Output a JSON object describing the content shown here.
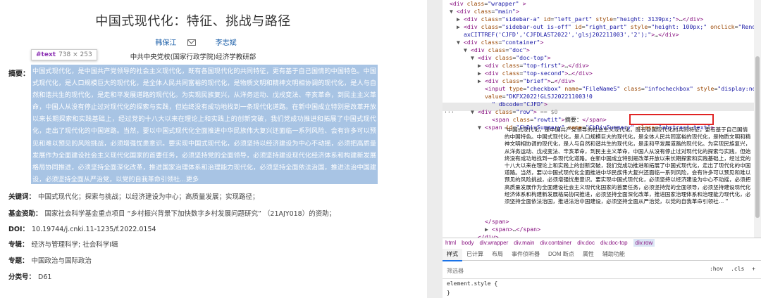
{
  "article": {
    "title": "中国式现代化：特征、挑战与路径",
    "authors": [
      "韩保江",
      "李志斌"
    ],
    "affiliation": "中共中央党校(国家行政学院)经济学教研部",
    "tooltip_tag": "#text",
    "tooltip_size": "738 × 253",
    "abstract_label": "摘要：",
    "abstract_text": "中国式现代化，是中国共产党领导的社会主义现代化，既有各国现代化的共同特征，更有基于自己国情的中国特色。中国式现代化，是人口规模巨大的现代化，是全体人民共同富裕的现代化，是物质文明和精神文明相协调的现代化，是人与自然和谐共生的现代化，是走和平发展道路的现代化。为实现民族复兴，从洋务运动、戊戌变法、辛亥革命，到民主主义革命，中国人从没有停止过对现代化的探索与实践，但始终没有成功地找到一条现代化道路。在新中国成立特别是改革开放以来长期探索和实践基础上，经过党的十八大以来在理论上和实践上的创新突破，我们党成功推进和拓展了中国式现代化，走出了现代化的中国道路。当然，要以中国式现代化全面推进中华民族伟大复兴还面临一系列风险、会有许多可以预见和难以预见的风险挑战，必须增强忧患意识。要实现中国式现代化，必须坚持以经济建设为中心不动摇，必须把高质量发展作为全面建设社会主义现代化国家的首要任务，必须坚持党的全面领导，必须坚持建设现代化经济体系和构建新发展格局协同推进，必须坚持全面深化改革，推进国家治理体系和治理能力现代化，必须坚持全面依法治国，推进法治中国建设，必须坚持全面从严治党，以党的自我革命引领社",
    "abstract_more": "...更多",
    "keywords_label": "关键词：",
    "keywords": "中国式现代化；探索与挑战；以经济建设为中心；高质量发展；实现路径；",
    "fund_label": "基金资助：",
    "fund": "国家社会科学基金重点项目 “乡村振兴背景下加快数字乡村发展问题研究” （21AJY018）的资助；",
    "doi_label": "DOI：",
    "doi": "10.19744/j.cnki.11-1235/f.2022.0154",
    "topic_label": "专辑：",
    "topic": "经济与管理科学; 社会科学Ⅰ辑",
    "subject_label": "专题：",
    "subject": "中国政治与国际政治",
    "class_label": "分类号：",
    "class": "D61"
  },
  "devtools": {
    "lines": [
      {
        "indent": 0,
        "tri": "",
        "html": "<span class='tg'>&lt;div</span> <span class='at'>class</span>=<span class='av'>\"wrapper\"</span> <span class='tg'>&gt;</span>"
      },
      {
        "indent": 1,
        "tri": "▼",
        "html": "<span class='tg'>&lt;div</span> <span class='at'>class</span>=<span class='av'>\"main\"</span><span class='tg'>&gt;</span>"
      },
      {
        "indent": 2,
        "tri": "▶",
        "html": "<span class='tg'>&lt;div</span> <span class='at'>class</span>=<span class='av'>\"sidebar-a\"</span> <span class='at'>id</span>=<span class='av'>\"left_part\"</span> <span class='at'>style</span>=<span class='av'>\"height: 3139px;\"</span><span class='tg'>&gt;</span>…<span class='tg'>&lt;/div&gt;</span>"
      },
      {
        "indent": 2,
        "tri": "▶",
        "html": "<span class='tg'>&lt;div</span> <span class='at'>class</span>=<span class='av'>\"sidebar-out is-off\"</span> <span class='at'>id</span>=<span class='av'>\"right_part\"</span> <span class='at'>style</span>=<span class='av'>\"height: 100px;\"</span> <span class='at'>onclick</span>=<span class='av'>\"RenderAj</span>"
      },
      {
        "indent": 2,
        "tri": "",
        "html": "<span class='av'>axCITTREF('CJFD','CJFDLAST2022','glsj202211003','2');\"</span><span class='tg'>&gt;</span>…<span class='tg'>&lt;/div&gt;</span>"
      },
      {
        "indent": 2,
        "tri": "▼",
        "html": "<span class='tg'>&lt;div</span> <span class='at'>class</span>=<span class='av'>\"container\"</span><span class='tg'>&gt;</span>"
      },
      {
        "indent": 3,
        "tri": "▼",
        "html": "<span class='tg'>&lt;div</span> <span class='at'>class</span>=<span class='av'>\"doc\"</span><span class='tg'>&gt;</span>"
      },
      {
        "indent": 4,
        "tri": "▼",
        "html": "<span class='tg'>&lt;div</span> <span class='at'>class</span>=<span class='av'>\"doc-top\"</span><span class='tg'>&gt;</span>"
      },
      {
        "indent": 5,
        "tri": "▶",
        "html": "<span class='tg'>&lt;div</span> <span class='at'>class</span>=<span class='av'>\"top-first\"</span><span class='tg'>&gt;</span>…<span class='tg'>&lt;/div&gt;</span>"
      },
      {
        "indent": 5,
        "tri": "▶",
        "html": "<span class='tg'>&lt;div</span> <span class='at'>class</span>=<span class='av'>\"top-second\"</span><span class='tg'>&gt;</span>…<span class='tg'>&lt;/div&gt;</span>"
      },
      {
        "indent": 5,
        "tri": "▶",
        "html": "<span class='tg'>&lt;div</span> <span class='at'>class</span>=<span class='av'>\"brief\"</span><span class='tg'>&gt;</span>…<span class='tg'>&lt;/div&gt;</span>"
      },
      {
        "indent": 5,
        "tri": "",
        "html": "<span class='tg'>&lt;input</span> <span class='at'>type</span>=<span class='av'>\"checkbox\"</span> <span class='at'>name</span>=<span class='av'>\"FileNameS\"</span> <span class='at'>class</span>=<span class='av'>\"infocheckbox\"</span> <span class='at'>style</span>=<span class='av'>\"display:none\"</span>"
      },
      {
        "indent": 5,
        "tri": "",
        "html": "<span class='at'>value</span>=<span class='av'>\"DKFX2022!GLSJ202211003!0</span>"
      },
      {
        "indent": 6,
        "tri": "",
        "html": "<span class='av'>\" dbcode=\"CJFD\"</span><span class='tg'>&gt;</span>"
      },
      {
        "indent": 4,
        "tri": "▼",
        "html": "<span class='tg'>&lt;div</span> <span class='at'>class</span>=<span class='av'>\"row\"</span><span class='tg'>&gt;</span> <span class='cm'>== $0</span>"
      },
      {
        "indent": 6,
        "tri": "",
        "html": "<span class='tg'>&lt;span</span> <span class='at'>class</span>=<span class='av'>\"rowtit\"</span><span class='tg'>&gt;</span><span class='tx'>摘要：</span><span class='tg'>&lt;/span&gt;</span>"
      },
      {
        "indent": 5,
        "tri": "▼",
        "html": "<span class='tg'>&lt;span</span> <span class='at'>id</span>=<span class='av'>\"ChDivSummary\"</span> <span class='at'>name</span>=<span class='av'>\"ChDivSummary\"</span> <span class='at'>class</span>=<span class='av'>\"abstract-text\"</span><span class='tg'>&gt;</span>"
      }
    ],
    "text_node": "\"中国式现代化，是中国共产党领导的社会主义现代化，既有各国现代化的共同特征，更有基于自己国情的中国特色。中国式现代化，是人口规模巨大的现代化，是全体人民共同富裕的现代化，是物质文明和精神文明相协调的现代化，是人与自然和谐共生的现代化，是走和平发展道路的现代化。为实现民族复兴，从洋务运动、戊戌变法、辛亥革命，到民主主义革命，中国人从没有停止过对现代化的探索与实践，但始终没有成功地找到一条现代化道路。在新中国成立特别是改革开放以来长期探索和实践基础上，经过党的十八大以来在理论上和实践上的创新突破，我们党成功推进和拓展了中国式现代化，走出了现代化的中国道路。当然，要以中国式现代化全面推进中华民族伟大复兴还面临一系列风险，会有许多可以预见和难以预见的风险挑战，必须增强忧患意识。要实现中国式现代化，必须坚持以经济建设为中心不动摇，必须把高质量发展作为全面建设社会主义现代化国家的首要任务，必须坚持党的全面领导，必须坚持建设现代化经济体系和构建新发展格局协同推进，必须坚持全面深化改革，推进国家治理体系和治理能力现代化，必须坚持全面依法治国，推进法治中国建设，必须坚持全面从严治党，以党的自我革命引领社…&nbsp;\"",
    "tail_lines": [
      {
        "indent": 5,
        "html": "<span class='tg'>&lt;/span&gt;</span>"
      },
      {
        "indent": 5,
        "html": "<span class='tri'>▶</span><span class='tg'>&lt;span&gt;</span>…<span class='tg'>&lt;/span&gt;</span>"
      },
      {
        "indent": 4,
        "html": "<span class='tg'>&lt;/div&gt;</span>"
      }
    ],
    "breadcrumbs": [
      "html",
      "body",
      "div.wrapper",
      "div.main",
      "div.container",
      "div.doc",
      "div.doc-top",
      "div.row"
    ],
    "tabs": [
      "样式",
      "已计算",
      "布局",
      "事件侦听器",
      "DOM 断点",
      "属性",
      "辅助功能"
    ],
    "filter_placeholder": "筛选器",
    "filter_tools": [
      ":hov",
      ".cls",
      "+"
    ],
    "element_style": "element.style {",
    "element_style_close": "}"
  },
  "colors": {
    "highlight": "#a8c4e4",
    "link": "#1a5ea8",
    "annotation": "#e02424"
  }
}
